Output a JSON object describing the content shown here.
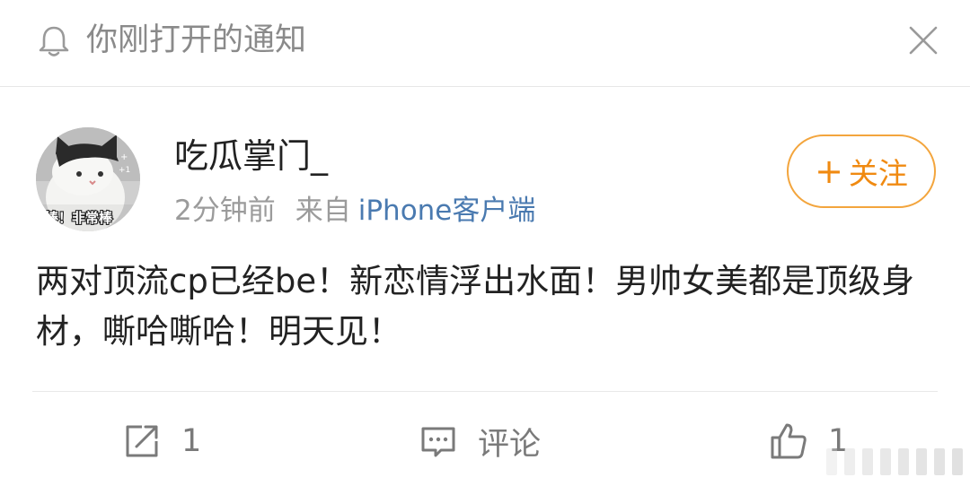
{
  "notification": {
    "text": "你刚打开的通知",
    "icon": "bell-icon",
    "close_icon": "close-icon"
  },
  "post": {
    "author": "吃瓜掌门_",
    "time": "2分钟前",
    "source_label": "来自",
    "device": "iPhone客户端",
    "follow_label": "关注",
    "avatar_caption": "棒！非常棒",
    "content": "两对顶流cp已经be！新恋情浮出水面！男帅女美都是顶级身材，嘶哈嘶哈！明天见！"
  },
  "actions": {
    "repost_count": "1",
    "comment_label": "评论",
    "like_count": "1"
  },
  "colors": {
    "follow_accent": "#f08a11",
    "link": "#4a7ab0",
    "muted": "#9b9b9b"
  }
}
